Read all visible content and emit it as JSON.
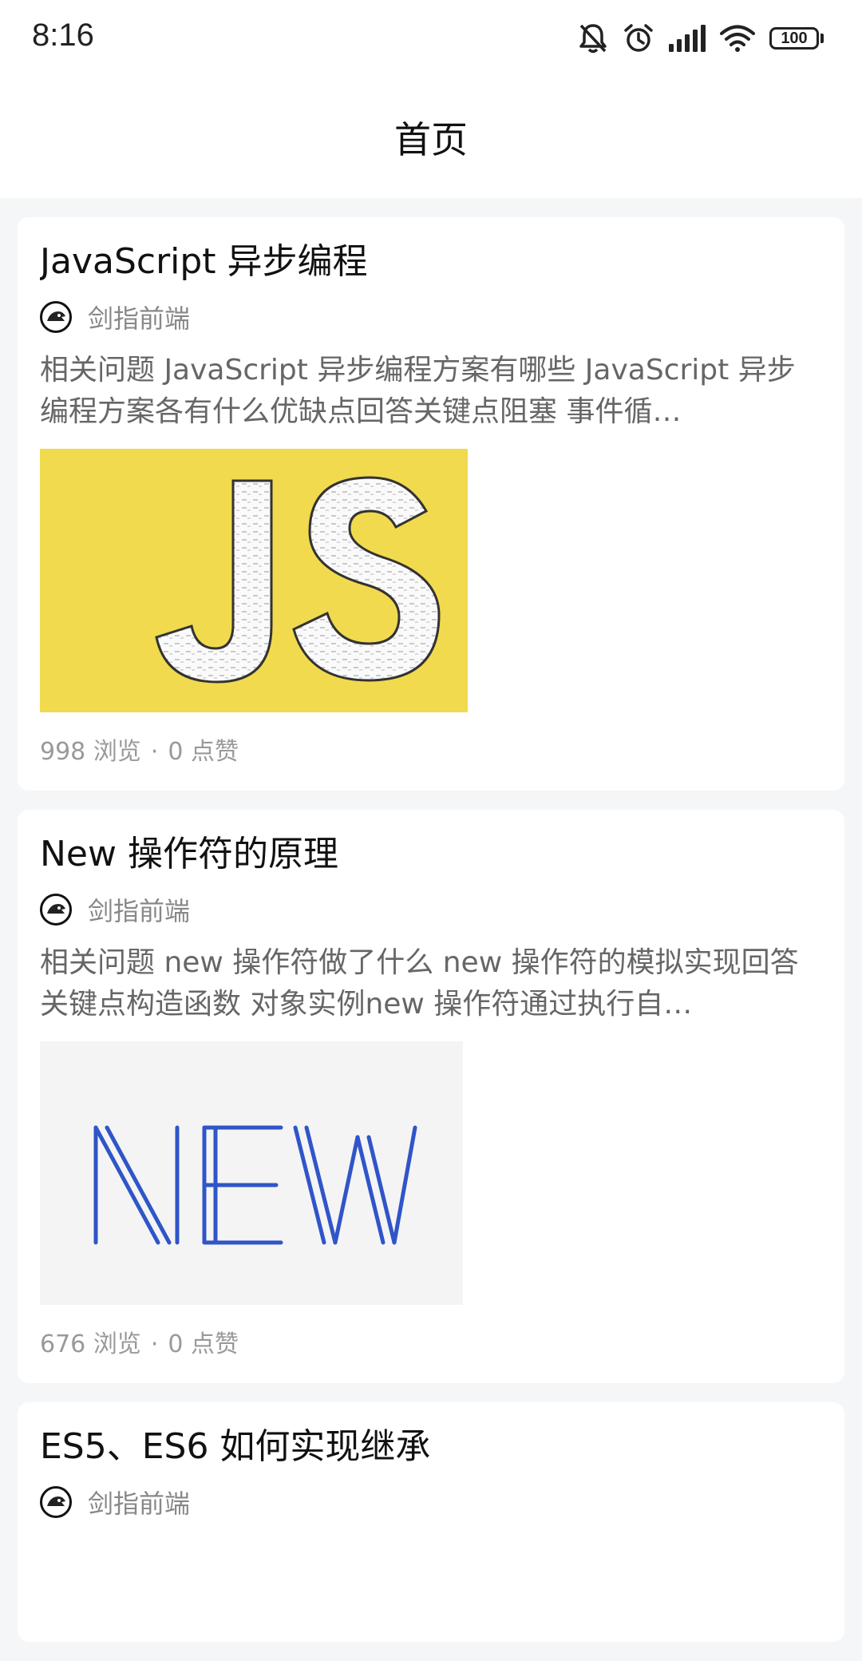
{
  "status_bar": {
    "time": "8:16",
    "battery": "100",
    "icons": [
      "bell-muted-icon",
      "alarm-icon",
      "signal-icon",
      "wifi-icon",
      "battery-icon"
    ]
  },
  "header": {
    "title": "首页"
  },
  "articles": [
    {
      "title": "JavaScript 异步编程",
      "author": "剑指前端",
      "excerpt": "相关问题  JavaScript 异步编程方案有哪些  JavaScript 异步编程方案各有什么优缺点回答关键点阻塞 事件循…",
      "thumbnail": {
        "text": "JS",
        "background": "#f1da4e"
      },
      "views": "998",
      "views_label": "浏览",
      "likes": "0",
      "likes_label": "点赞",
      "separator": "·"
    },
    {
      "title": "New 操作符的原理",
      "author": "剑指前端",
      "excerpt": "相关问题  new 操作符做了什么  new 操作符的模拟实现回答关键点构造函数 对象实例new 操作符通过执行自…",
      "thumbnail": {
        "text": "NEW",
        "background": "#f4f4f4",
        "color": "#2f55c8"
      },
      "views": "676",
      "views_label": "浏览",
      "likes": "0",
      "likes_label": "点赞",
      "separator": "·"
    },
    {
      "title": "ES5、ES6 如何实现继承",
      "author": "剑指前端"
    }
  ]
}
